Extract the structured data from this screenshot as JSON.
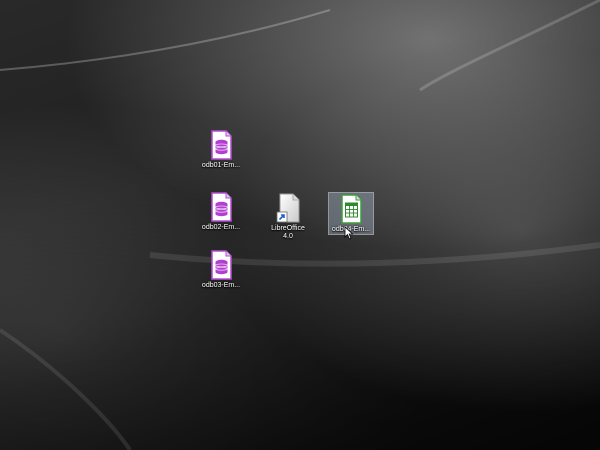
{
  "desktop": {
    "icons": [
      {
        "label": "odb01-Em...",
        "icon": "libreoffice-base-database-icon",
        "color": "#a23fbf"
      },
      {
        "label": "odb02-Em...",
        "icon": "libreoffice-base-database-icon",
        "color": "#a23fbf"
      },
      {
        "label": "odb03-Em...",
        "icon": "libreoffice-base-database-icon",
        "color": "#a23fbf"
      },
      {
        "label": "LibreOffice\n4.0",
        "icon": "libreoffice-shortcut-icon",
        "color": "#e6e6e6"
      },
      {
        "label": "odb04-Em...",
        "icon": "libreoffice-calc-spreadsheet-icon",
        "color": "#3a9a3a"
      }
    ]
  }
}
